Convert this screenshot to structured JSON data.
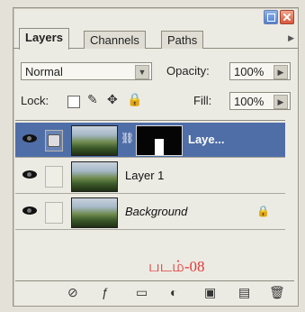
{
  "tabs": [
    {
      "label": "Layers"
    },
    {
      "label": "Channels"
    },
    {
      "label": "Paths"
    }
  ],
  "blend_mode": "Normal",
  "opacity": {
    "label": "Opacity:",
    "value": "100%"
  },
  "lock": {
    "label": "Lock:"
  },
  "fill": {
    "label": "Fill:",
    "value": "100%"
  },
  "layers": [
    {
      "name": "Laye...",
      "selected": true
    },
    {
      "name": "Layer 1",
      "selected": false
    },
    {
      "name": "Background",
      "selected": false,
      "locked": true
    }
  ],
  "caption": "படம்-08",
  "colors": {
    "selection": "#4f6ea8",
    "caption": "#e23a3a"
  }
}
